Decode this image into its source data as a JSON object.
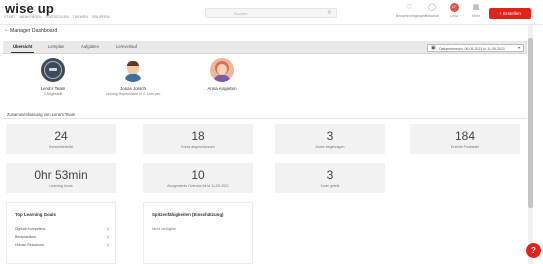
{
  "header": {
    "logo": "wise up",
    "nav": [
      "START",
      "MEIN PROFIL",
      "ENTDECKEN",
      "THEMEN",
      "GRUPPEN"
    ],
    "search_placeholder": "Suchen",
    "items": [
      {
        "label": "Benachrichtigungen",
        "icon": "bell-icon"
      },
      {
        "label": "Relaunch",
        "icon": "help-circle-icon"
      },
      {
        "label": "Lena",
        "icon": "avatar",
        "initials": "LY"
      },
      {
        "label": "Mehr",
        "icon": "grid-icon"
      }
    ],
    "create_label": "Erstellen"
  },
  "title": "Manager Dashboard",
  "tabs": [
    "Übersicht",
    "Lernplan",
    "Aufgaben",
    "Lernverlauf"
  ],
  "date_filter": "Datumsbereich: 06-05-2021 to 11-05-2021",
  "people": [
    {
      "name": "Lena's Team",
      "sub": "2 Angestellt",
      "avatar": "team"
    },
    {
      "name": "Jonas Jorsch",
      "sub": "Lerning Hopesultant VI 2. Lern.pm",
      "avatar": "man"
    },
    {
      "name": "Anna Angarten",
      "sub": "",
      "avatar": "woman"
    }
  ],
  "summary_title": "Zusammenfassung von Lena's Team",
  "stats": [
    {
      "value": "24",
      "label": "Kursanfaktivität"
    },
    {
      "value": "18",
      "label": "Kurse abgeschlossen"
    },
    {
      "value": "3",
      "label": "Kurse begebragen"
    },
    {
      "value": "184",
      "label": "Erzielte Punktzahl"
    },
    {
      "value": "0hr 53min",
      "label": "Learning hours"
    },
    {
      "value": "10",
      "label": "Assignments Overdue As of 11-05-2021"
    },
    {
      "value": "3",
      "label": "Karte geteilt"
    }
  ],
  "goals": {
    "title": "Top Learning Goals",
    "rows": [
      {
        "label": "Digitale Kompetenz",
        "count": "1"
      },
      {
        "label": "Bestpractices",
        "count": "1"
      },
      {
        "label": "Human Resources",
        "count": "1"
      }
    ]
  },
  "skills": {
    "title": "Spitzenfähigkeiten (Einschätzung)",
    "empty": "Nicht verfügbar"
  },
  "help_label": "?",
  "colors": {
    "accent": "#e2231a",
    "tabbar": "#e9e9e9",
    "card": "#f2f2f2"
  }
}
